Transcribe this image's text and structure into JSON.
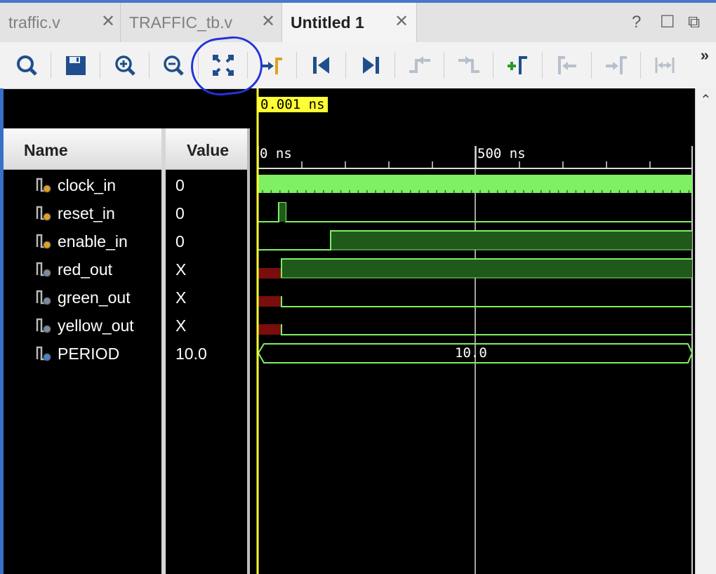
{
  "tabs": [
    {
      "label": "traffic.v",
      "active": false
    },
    {
      "label": "TRAFFIC_tb.v",
      "active": false
    },
    {
      "label": "Untitled 1",
      "active": true
    }
  ],
  "window_controls": {
    "help": "?",
    "maximize": "☐",
    "float": "⧉"
  },
  "toolbar": {
    "buttons": [
      "search-icon",
      "save-icon",
      "zoom-in-icon",
      "zoom-out-icon",
      "zoom-fit-icon",
      "go-to-cursor-icon",
      "go-to-time-zero-icon",
      "go-to-last-time-icon",
      "previous-transition-icon",
      "next-transition-icon",
      "add-marker-icon",
      "previous-marker-icon",
      "next-marker-icon",
      "swap-cursors-icon"
    ],
    "more": "»"
  },
  "columns": {
    "name": "Name",
    "value": "Value"
  },
  "signals": [
    {
      "name": "clock_in",
      "value": "0",
      "kind": "input-bit"
    },
    {
      "name": "reset_in",
      "value": "0",
      "kind": "input-bit"
    },
    {
      "name": "enable_in",
      "value": "0",
      "kind": "input-bit"
    },
    {
      "name": "red_out",
      "value": "X",
      "kind": "output-bit"
    },
    {
      "name": "green_out",
      "value": "X",
      "kind": "output-bit"
    },
    {
      "name": "yellow_out",
      "value": "X",
      "kind": "output-bit"
    },
    {
      "name": "PERIOD",
      "value": "10.0",
      "kind": "parameter"
    }
  ],
  "waveform": {
    "cursor_label": "0.001 ns",
    "time_labels": [
      "0 ns",
      "500 ns"
    ],
    "bus_value": "10.0",
    "colors": {
      "wave": "#7ef062",
      "wave_fill": "#1f5a1a",
      "unknown": "#7a0d0d",
      "cursor": "#ffff33",
      "grid": "#dcdcdc"
    }
  }
}
